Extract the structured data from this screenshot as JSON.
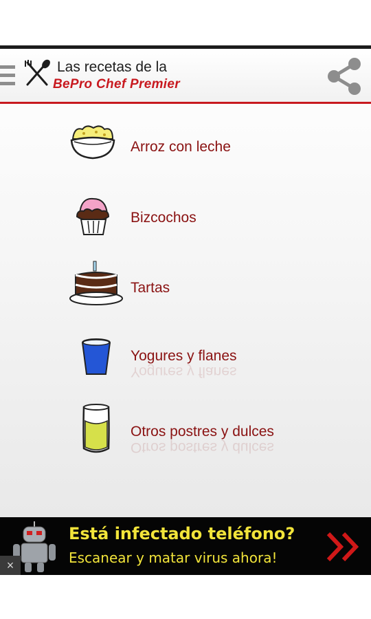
{
  "header": {
    "title_line1": "Las recetas de la",
    "title_line2": "BePro Chef Premier",
    "menu_icon": "hamburger-icon",
    "logo_icon": "crossed-utensils-icon",
    "share_icon": "share-icon"
  },
  "categories": [
    {
      "label": "Arroz con leche",
      "icon": "rice-pudding-bowl-icon"
    },
    {
      "label": "Bizcochos",
      "icon": "cupcake-icon"
    },
    {
      "label": "Tartas",
      "icon": "birthday-cake-icon"
    },
    {
      "label": "Yogures y flanes",
      "icon": "blue-cup-icon"
    },
    {
      "label": "Otros postres y dulces",
      "icon": "glass-drink-icon"
    }
  ],
  "ad": {
    "line1": "Está infectado teléfono?",
    "line2": "Escanear y matar virus ahora!",
    "close": "×",
    "robot_icon": "android-robot-icon",
    "arrow_icon": "double-chevron-right-icon"
  },
  "colors": {
    "accent": "#c8191f",
    "label": "#8a1212",
    "ad_text": "#f2e43a",
    "ad_background": "#050505"
  }
}
